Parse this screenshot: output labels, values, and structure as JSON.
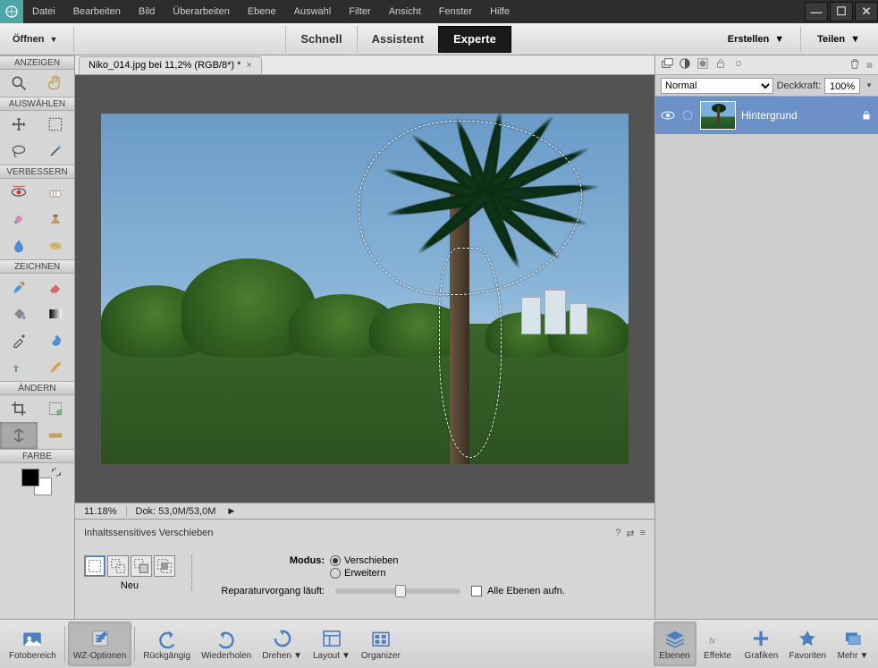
{
  "menu": {
    "items": [
      "Datei",
      "Bearbeiten",
      "Bild",
      "Überarbeiten",
      "Ebene",
      "Auswahl",
      "Filter",
      "Ansicht",
      "Fenster",
      "Hilfe"
    ]
  },
  "modebar": {
    "open": "Öffnen",
    "tabs": [
      {
        "label": "Schnell",
        "active": false
      },
      {
        "label": "Assistent",
        "active": false
      },
      {
        "label": "Experte",
        "active": true
      }
    ],
    "create": "Erstellen",
    "share": "Teilen"
  },
  "toolbox": {
    "groups": {
      "view": "ANZEIGEN",
      "select": "AUSWÄHLEN",
      "enhance": "VERBESSERN",
      "draw": "ZEICHNEN",
      "modify": "ÄNDERN",
      "color": "FARBE"
    }
  },
  "document": {
    "tab_title": "Niko_014.jpg bei 11,2% (RGB/8*) *",
    "zoom": "11.18%",
    "doc_info": "Dok: 53,0M/53,0M"
  },
  "tool_options": {
    "title": "Inhaltssensitives Verschieben",
    "new_label": "Neu",
    "mode_label": "Modus:",
    "mode_move": "Verschieben",
    "mode_extend": "Erweitern",
    "repair_label": "Reparaturvorgang läuft:",
    "all_layers": "Alle Ebenen aufn."
  },
  "layers": {
    "blend_mode": "Normal",
    "opacity_label": "Deckkraft:",
    "opacity_value": "100%",
    "layer0": {
      "name": "Hintergrund"
    }
  },
  "bottombar": {
    "items": [
      "Fotobereich",
      "WZ-Optionen",
      "Rückgängig",
      "Wiederholen",
      "Drehen",
      "Layout",
      "Organizer"
    ],
    "right_items": [
      "Ebenen",
      "Effekte",
      "Grafiken",
      "Favoriten",
      "Mehr"
    ]
  }
}
